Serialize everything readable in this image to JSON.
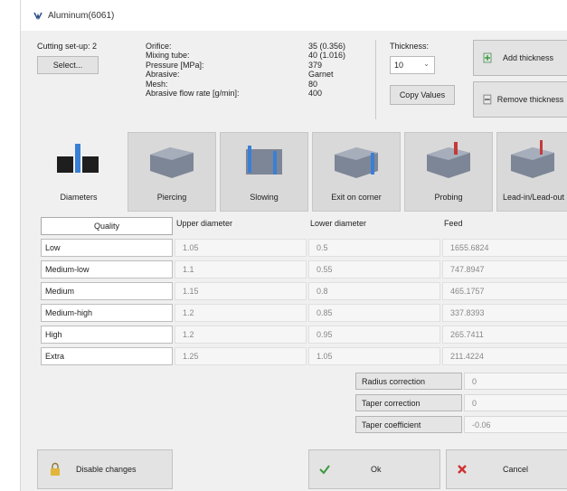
{
  "window": {
    "title": "Aluminum(6061)"
  },
  "cutting_setup": {
    "label": "Cutting set-up: 2",
    "select_button": "Select..."
  },
  "parameters": [
    {
      "key": "Orifice:",
      "value": "35 (0.356)"
    },
    {
      "key": "Mixing tube:",
      "value": "40 (1.016)"
    },
    {
      "key": "Pressure [MPa]:",
      "value": "379"
    },
    {
      "key": "Abrasive:",
      "value": "Garnet"
    },
    {
      "key": "Mesh:",
      "value": "80"
    },
    {
      "key": "Abrasive flow rate [g/min]:",
      "value": "400"
    }
  ],
  "thickness": {
    "label": "Thickness:",
    "value": "10",
    "copy_button": "Copy Values"
  },
  "actions": {
    "add_thickness": "Add thickness",
    "remove_thickness": "Remove thickness"
  },
  "tabs": [
    {
      "label": "Diameters",
      "icon": "diameters-icon"
    },
    {
      "label": "Piercing",
      "icon": "piercing-icon"
    },
    {
      "label": "Slowing",
      "icon": "slowing-icon"
    },
    {
      "label": "Exit on corner",
      "icon": "exit-corner-icon"
    },
    {
      "label": "Probing",
      "icon": "probing-icon"
    },
    {
      "label": "Lead-in/Lead-out",
      "icon": "lead-in-icon"
    }
  ],
  "table": {
    "headers": {
      "quality": "Quality",
      "upper": "Upper diameter",
      "lower": "Lower diameter",
      "feed": "Feed"
    },
    "rows": [
      {
        "quality": "Low",
        "upper": "1.05",
        "lower": "0.5",
        "feed": "1655.6824"
      },
      {
        "quality": "Medium-low",
        "upper": "1.1",
        "lower": "0.55",
        "feed": "747.8947"
      },
      {
        "quality": "Medium",
        "upper": "1.15",
        "lower": "0.8",
        "feed": "465.1757"
      },
      {
        "quality": "Medium-high",
        "upper": "1.2",
        "lower": "0.85",
        "feed": "337.8393"
      },
      {
        "quality": "High",
        "upper": "1.2",
        "lower": "0.95",
        "feed": "265.7411"
      },
      {
        "quality": "Extra",
        "upper": "1.25",
        "lower": "1.05",
        "feed": "211.4224"
      }
    ]
  },
  "corrections": [
    {
      "label": "Radius correction",
      "value": "0"
    },
    {
      "label": "Taper correction",
      "value": "0"
    },
    {
      "label": "Taper coefficient",
      "value": "-0.06"
    }
  ],
  "footer": {
    "disable_changes": "Disable changes",
    "ok": "Ok",
    "cancel": "Cancel"
  },
  "colors": {
    "ok_green": "#3c9a3c",
    "cancel_red": "#d23030",
    "lock_yellow": "#e2b43a",
    "icon_blue": "#3a7fd5"
  }
}
